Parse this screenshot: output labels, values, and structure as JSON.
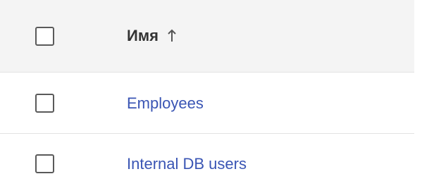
{
  "table": {
    "header": {
      "column_name": "Имя",
      "sort_icon": "arrow-up-icon",
      "sort_direction": "ascending"
    },
    "rows": [
      {
        "name": "Employees"
      },
      {
        "name": "Internal DB users"
      }
    ]
  },
  "colors": {
    "header_background": "#f4f4f4",
    "link": "#3a55b4",
    "checkbox_border": "#5a5a5a",
    "divider": "#e3e3e3"
  }
}
